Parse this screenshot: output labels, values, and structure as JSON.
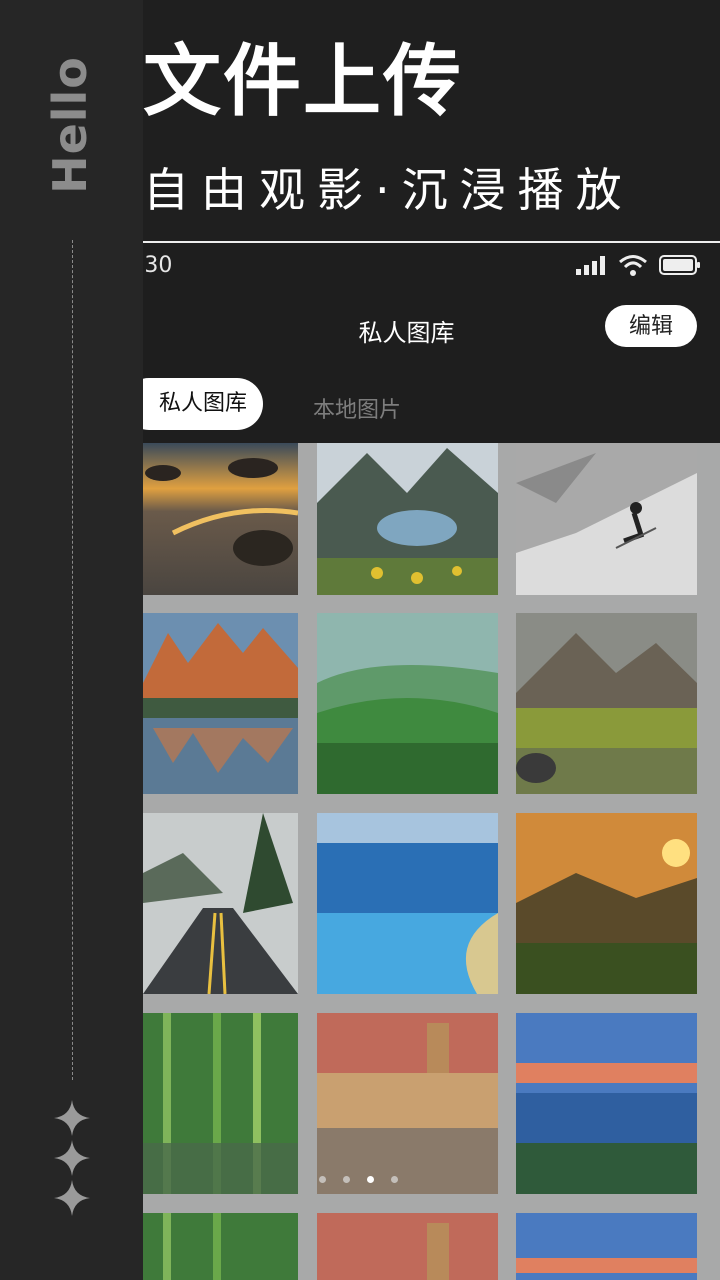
{
  "side": {
    "hello": "Hello"
  },
  "header": {
    "headline": "文件上传",
    "subline": "自由观影·沉浸播放"
  },
  "statusbar": {
    "time": ":30"
  },
  "navbar": {
    "title": "私人图库",
    "edit_label": "编辑"
  },
  "tabs": [
    {
      "label": "私人图库",
      "active": true
    },
    {
      "label": "本地图片",
      "active": false
    }
  ],
  "photos": [
    {
      "subject": "beach sunset with rocks"
    },
    {
      "subject": "mountain lake with wildflowers"
    },
    {
      "subject": "skier on snowy slope"
    },
    {
      "subject": "alpine peaks reflected in lake"
    },
    {
      "subject": "misty green hills"
    },
    {
      "subject": "mountain lake with forest"
    },
    {
      "subject": "wet road through forest"
    },
    {
      "subject": "blue sea and beach"
    },
    {
      "subject": "sunset over mountain valley"
    },
    {
      "subject": "bamboo forest"
    },
    {
      "subject": "old town square at sunset"
    },
    {
      "subject": "crater lake at dawn"
    },
    {
      "subject": "bamboo forest"
    },
    {
      "subject": "old town square at sunset"
    },
    {
      "subject": "crater lake at dawn"
    }
  ],
  "colors": {
    "background": "#1f1f1f",
    "grid_background": "#a8a9a9",
    "accent": "#ffffff"
  }
}
